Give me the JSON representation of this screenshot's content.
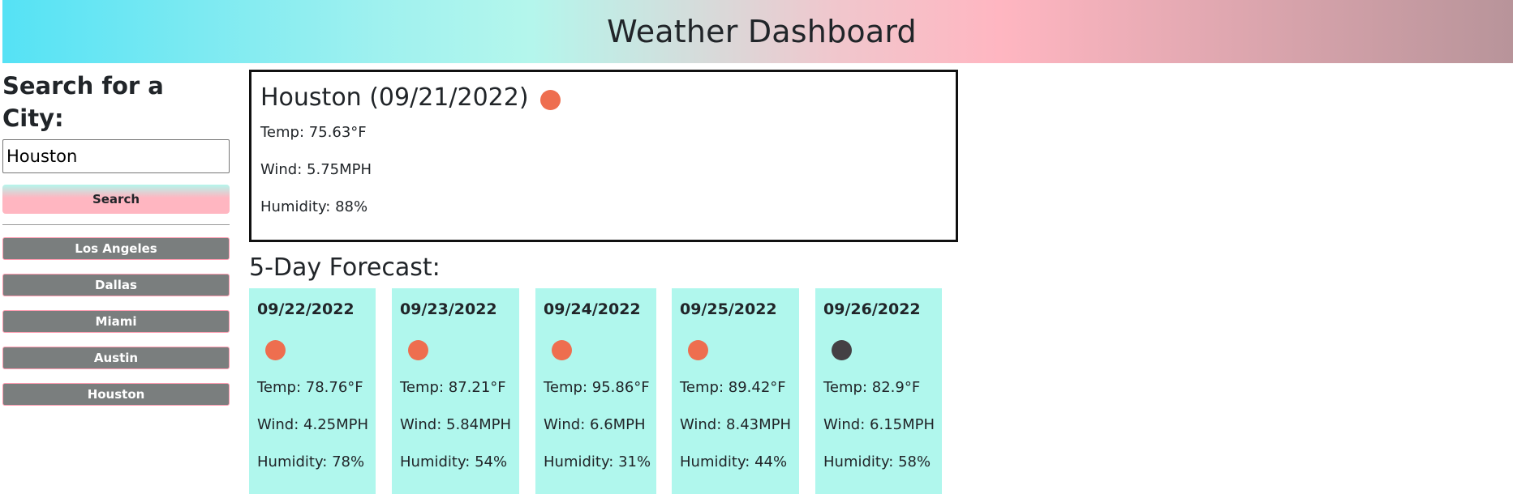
{
  "header": {
    "title": "Weather Dashboard"
  },
  "sidebar": {
    "heading": "Search for a City:",
    "search_value": "Houston",
    "search_button": "Search",
    "history": [
      "Los Angeles",
      "Dallas",
      "Miami",
      "Austin",
      "Houston"
    ]
  },
  "current": {
    "title": "Houston (09/21/2022)",
    "icon": "sun-icon",
    "icon_color": "#ee6e4f",
    "temp": "Temp: 75.63°F",
    "wind": "Wind: 5.75MPH",
    "humidity": "Humidity: 88%"
  },
  "forecast": {
    "heading": "5-Day Forecast:",
    "days": [
      {
        "date": "09/22/2022",
        "icon": "sun-icon",
        "icon_color": "#ee6e4f",
        "temp": "Temp: 78.76°F",
        "wind": "Wind: 4.25MPH",
        "humidity": "Humidity: 78%"
      },
      {
        "date": "09/23/2022",
        "icon": "sun-icon",
        "icon_color": "#ee6e4f",
        "temp": "Temp: 87.21°F",
        "wind": "Wind: 5.84MPH",
        "humidity": "Humidity: 54%"
      },
      {
        "date": "09/24/2022",
        "icon": "sun-icon",
        "icon_color": "#ee6e4f",
        "temp": "Temp: 95.86°F",
        "wind": "Wind: 6.6MPH",
        "humidity": "Humidity: 31%"
      },
      {
        "date": "09/25/2022",
        "icon": "sun-icon",
        "icon_color": "#ee6e4f",
        "temp": "Temp: 89.42°F",
        "wind": "Wind: 8.43MPH",
        "humidity": "Humidity: 44%"
      },
      {
        "date": "09/26/2022",
        "icon": "moon-icon",
        "icon_color": "#444044",
        "temp": "Temp: 82.9°F",
        "wind": "Wind: 6.15MPH",
        "humidity": "Humidity: 58%"
      }
    ]
  }
}
